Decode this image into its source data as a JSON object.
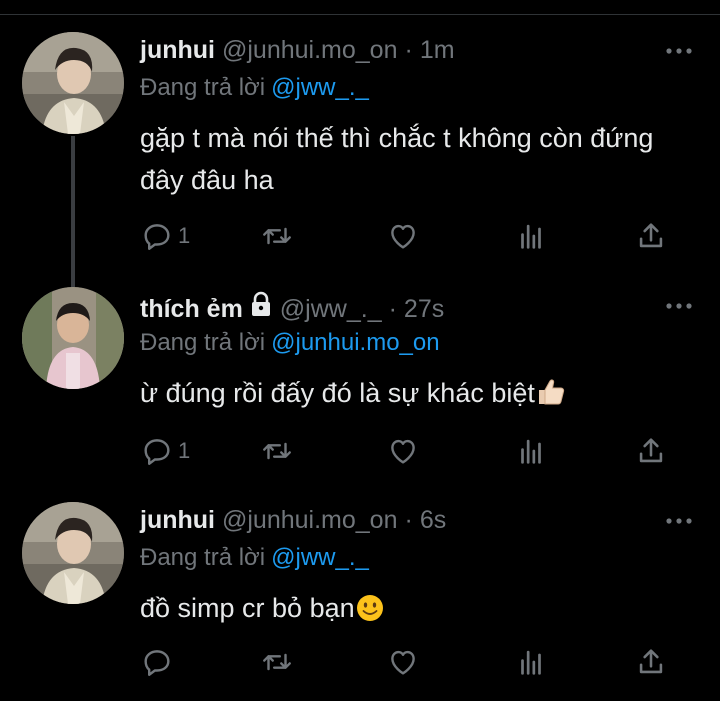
{
  "tweets": [
    {
      "name": "junhui",
      "handle": "@junhui.mo_on",
      "dot": "·",
      "time": "1m",
      "replying_prefix": "Đang trả lời",
      "replying_to": "@jww_._",
      "text": "gặp t mà nói thế thì chắc t không còn đứng đây đâu ha",
      "reply_count": "1",
      "locked": false
    },
    {
      "name": "thích ẻm",
      "handle": "@jww_._",
      "dot": "·",
      "time": "27s",
      "replying_prefix": "Đang trả lời",
      "replying_to": "@junhui.mo_on",
      "text": "ừ đúng rồi đấy đó là sự khác biệt",
      "reply_count": "1",
      "locked": true
    },
    {
      "name": "junhui",
      "handle": "@junhui.mo_on",
      "dot": "·",
      "time": "6s",
      "replying_prefix": "Đang trả lời",
      "replying_to": "@jww_._",
      "text": "đồ simp cr bỏ bạn",
      "reply_count": "",
      "locked": false
    }
  ],
  "icons": {
    "reply": "reply-icon",
    "retweet": "retweet-icon",
    "like": "like-icon",
    "views": "views-icon",
    "share": "share-icon",
    "more": "more-icon",
    "lock": "lock-icon",
    "emoji_tweet2": "thumbs-up-emoji",
    "emoji_tweet3": "smiling-face-emoji"
  },
  "colors": {
    "background": "#000000",
    "text": "#e7e9ea",
    "secondary": "#71767b",
    "link": "#1d9bf0",
    "thread_line": "#3a3d41"
  }
}
